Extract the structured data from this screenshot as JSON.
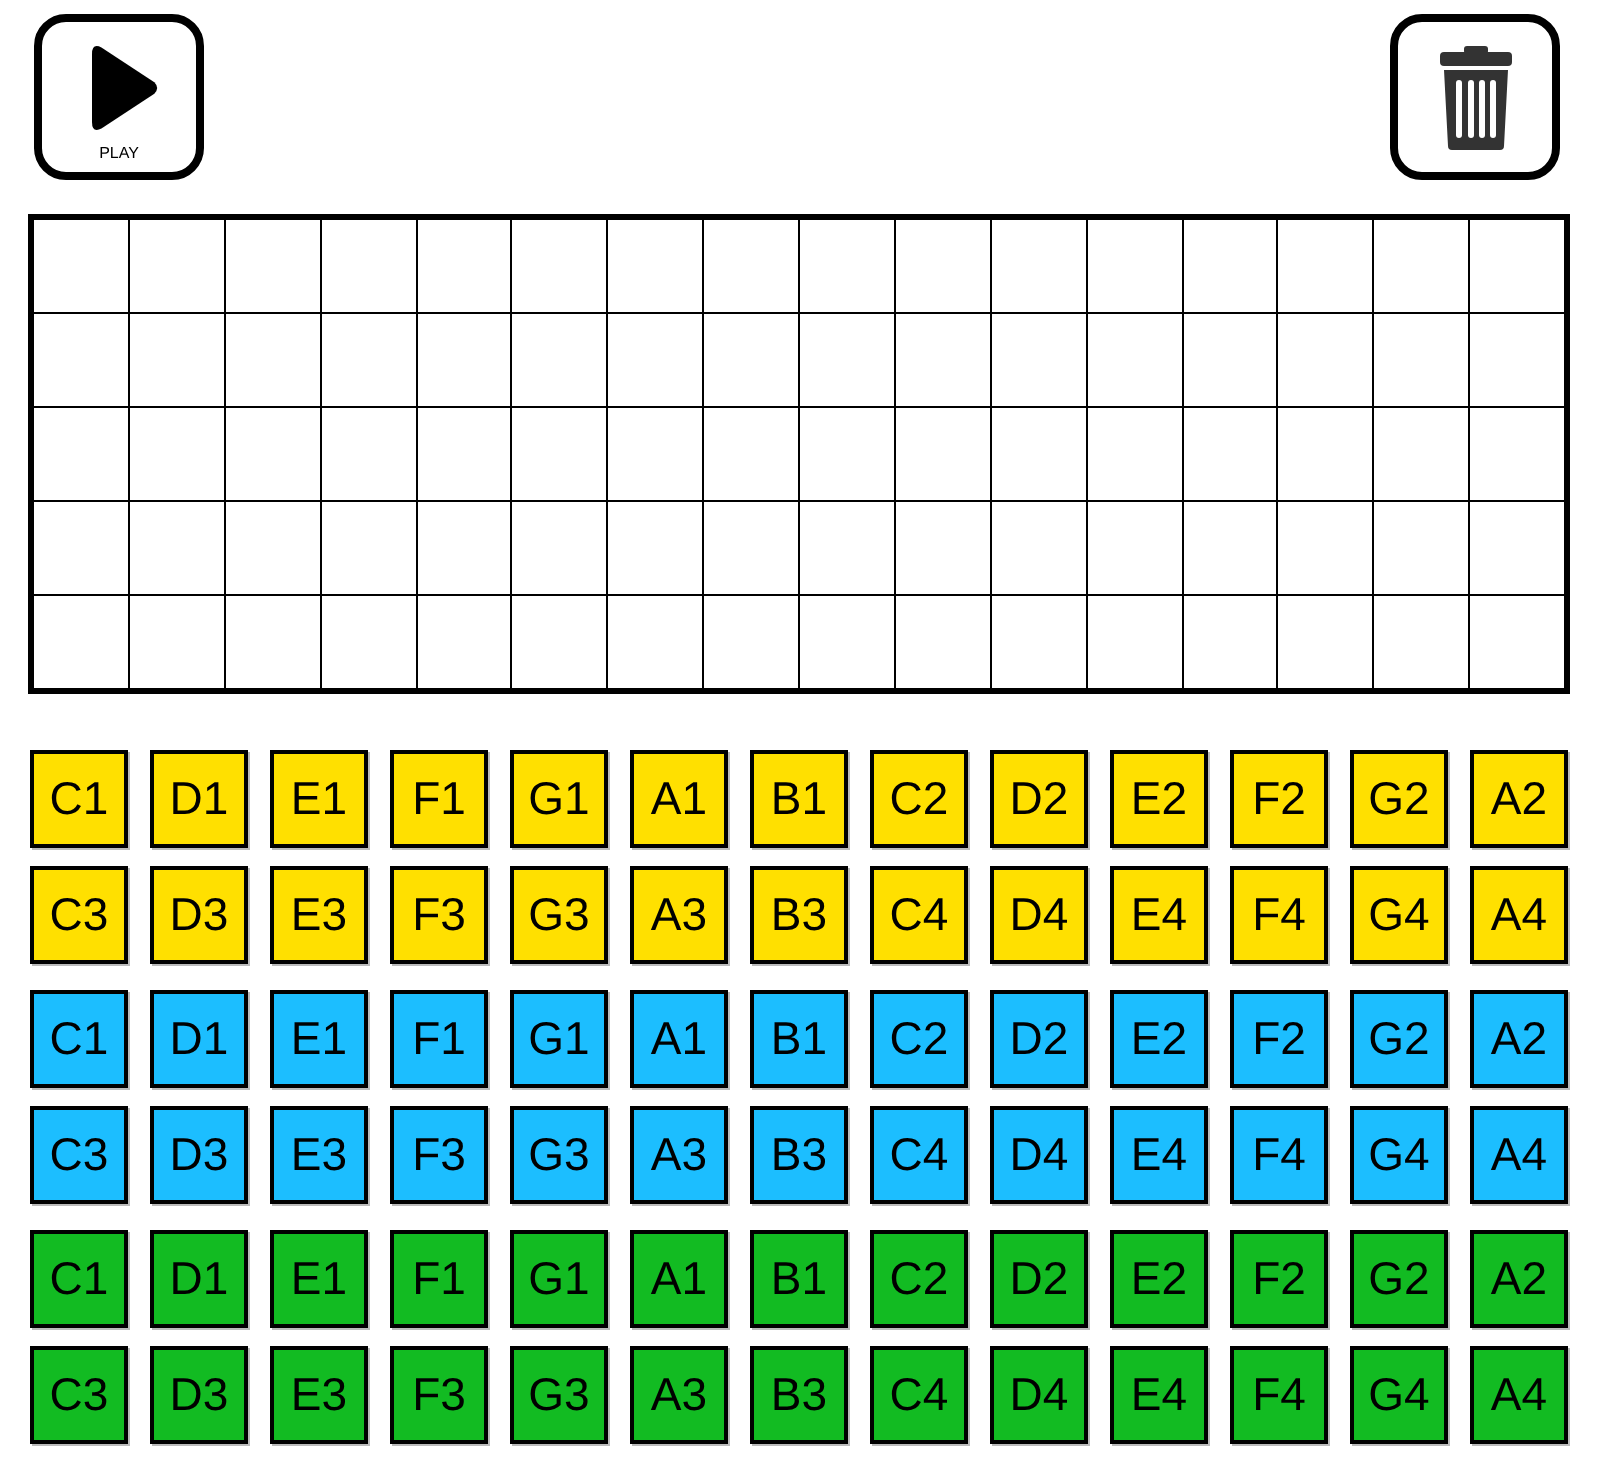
{
  "toolbar": {
    "play_button": {
      "label": "PLAY"
    }
  },
  "grid": {
    "rows": [
      {
        "cells": [
          {
            "on": false
          },
          {
            "on": false
          },
          {
            "on": false
          },
          {
            "on": false
          },
          {
            "on": false
          },
          {
            "on": false
          },
          {
            "on": false
          },
          {
            "on": false
          },
          {
            "on": false
          },
          {
            "on": false
          },
          {
            "on": false
          },
          {
            "on": false
          },
          {
            "on": false
          },
          {
            "on": false
          },
          {
            "on": false
          },
          {
            "on": false
          }
        ]
      },
      {
        "cells": [
          {
            "on": false
          },
          {
            "on": false
          },
          {
            "on": false
          },
          {
            "on": false
          },
          {
            "on": false
          },
          {
            "on": false
          },
          {
            "on": false
          },
          {
            "on": false
          },
          {
            "on": false
          },
          {
            "on": false
          },
          {
            "on": false
          },
          {
            "on": false
          },
          {
            "on": false
          },
          {
            "on": false
          },
          {
            "on": false
          },
          {
            "on": false
          }
        ]
      },
      {
        "cells": [
          {
            "on": false
          },
          {
            "on": false
          },
          {
            "on": false
          },
          {
            "on": false
          },
          {
            "on": false
          },
          {
            "on": false
          },
          {
            "on": false
          },
          {
            "on": false
          },
          {
            "on": false
          },
          {
            "on": false
          },
          {
            "on": false
          },
          {
            "on": false
          },
          {
            "on": false
          },
          {
            "on": false
          },
          {
            "on": false
          },
          {
            "on": false
          }
        ]
      },
      {
        "cells": [
          {
            "on": false
          },
          {
            "on": false
          },
          {
            "on": false
          },
          {
            "on": false
          },
          {
            "on": false
          },
          {
            "on": false
          },
          {
            "on": false
          },
          {
            "on": false
          },
          {
            "on": false
          },
          {
            "on": false
          },
          {
            "on": false
          },
          {
            "on": false
          },
          {
            "on": false
          },
          {
            "on": false
          },
          {
            "on": false
          },
          {
            "on": false
          }
        ]
      },
      {
        "cells": [
          {
            "on": false
          },
          {
            "on": false
          },
          {
            "on": false
          },
          {
            "on": false
          },
          {
            "on": false
          },
          {
            "on": false
          },
          {
            "on": false
          },
          {
            "on": false
          },
          {
            "on": false
          },
          {
            "on": false
          },
          {
            "on": false
          },
          {
            "on": false
          },
          {
            "on": false
          },
          {
            "on": false
          },
          {
            "on": false
          },
          {
            "on": false
          }
        ]
      }
    ]
  },
  "key_banks": [
    {
      "color": "#ffe000",
      "rows": [
        [
          "C1",
          "D1",
          "E1",
          "F1",
          "G1",
          "A1",
          "B1",
          "C2",
          "D2",
          "E2",
          "F2",
          "G2",
          "A2"
        ],
        [
          "C3",
          "D3",
          "E3",
          "F3",
          "G3",
          "A3",
          "B3",
          "C4",
          "D4",
          "E4",
          "F4",
          "G4",
          "A4"
        ]
      ]
    },
    {
      "color": "#1cbeff",
      "rows": [
        [
          "C1",
          "D1",
          "E1",
          "F1",
          "G1",
          "A1",
          "B1",
          "C2",
          "D2",
          "E2",
          "F2",
          "G2",
          "A2"
        ],
        [
          "C3",
          "D3",
          "E3",
          "F3",
          "G3",
          "A3",
          "B3",
          "C4",
          "D4",
          "E4",
          "F4",
          "G4",
          "A4"
        ]
      ]
    },
    {
      "color": "#12bb22",
      "rows": [
        [
          "C1",
          "D1",
          "E1",
          "F1",
          "G1",
          "A1",
          "B1",
          "C2",
          "D2",
          "E2",
          "F2",
          "G2",
          "A2"
        ],
        [
          "C3",
          "D3",
          "E3",
          "F3",
          "G3",
          "A3",
          "B3",
          "C4",
          "D4",
          "E4",
          "F4",
          "G4",
          "A4"
        ]
      ]
    }
  ]
}
